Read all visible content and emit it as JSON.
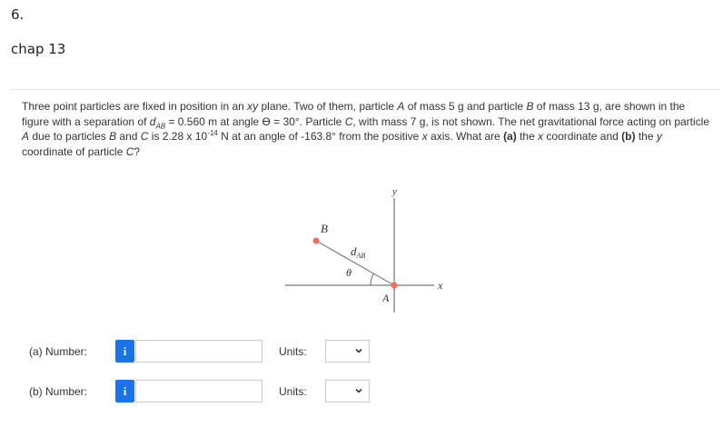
{
  "header": {
    "question_number": "6.",
    "chapter": "chap 13"
  },
  "problem": {
    "t1": "Three point particles are fixed in position in an ",
    "t_xy": "xy",
    "t2": " plane. Two of them, particle ",
    "t_A": "A",
    "t3": " of mass 5 g and particle ",
    "t_B": "B",
    "t4": " of mass 13 g, are shown in the figure with a separation of ",
    "t_d": "d",
    "t_dsub": "AB",
    "t5": " = 0.560 m at angle ϴ = 30°. Particle ",
    "t_C": "C",
    "t6": ", with mass 7 g, is not shown. The net gravitational force acting on particle ",
    "t_A2": "A",
    "t7": " due to particles ",
    "t_B2": "B",
    "t8": " and ",
    "t_C2": "C",
    "t9": " is 2.28 x 10",
    "t_exp": "-14",
    "t10": " N at an angle of -163.8° from the positive ",
    "t_x": "x",
    "t11": " axis. What are ",
    "t_pa": "(a)",
    "t12": " the ",
    "t_x2": "x",
    "t13": " coordinate and ",
    "t_pb": "(b)",
    "t14": " the ",
    "t_y": "y",
    "t15": " coordinate of particle ",
    "t_C3": "C",
    "t16": "?"
  },
  "figure": {
    "label_y": "y",
    "label_x": "x",
    "label_B": "B",
    "label_A": "A",
    "label_theta": "θ",
    "label_d": "d",
    "label_dsub": "AB",
    "point_color": "#f26d5b"
  },
  "answers": [
    {
      "label": "(a)  Number:",
      "info_icon": "i",
      "value": "",
      "units_label": "Units:",
      "units_value": ""
    },
    {
      "label": "(b)  Number:",
      "info_icon": "i",
      "value": "",
      "units_label": "Units:",
      "units_value": ""
    }
  ],
  "colors": {
    "accent": "#1a73e8",
    "border": "#c9c9c9"
  }
}
